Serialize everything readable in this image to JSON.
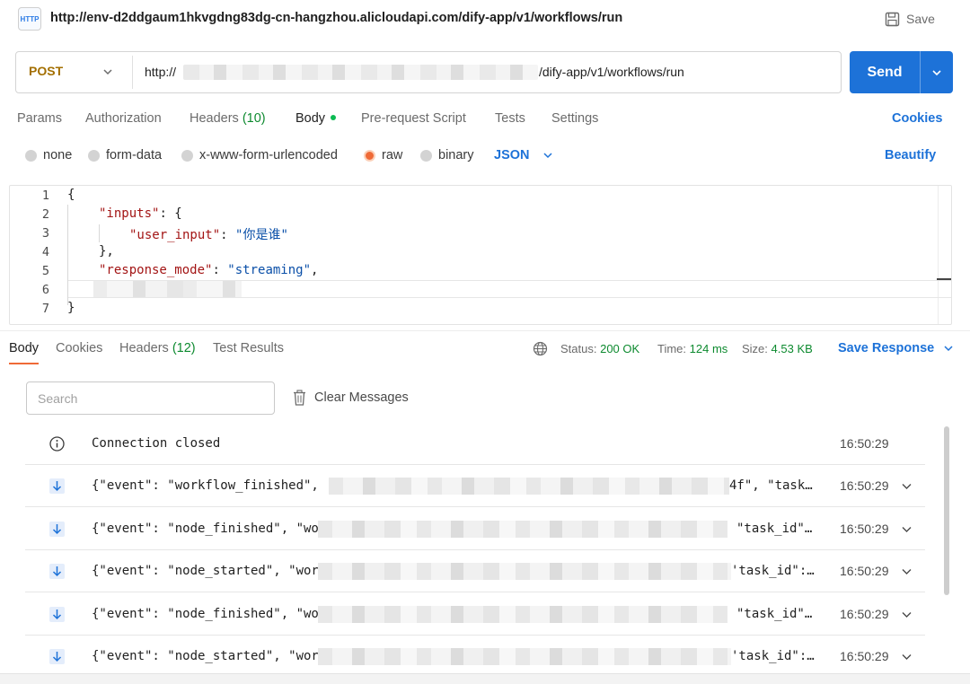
{
  "request": {
    "title": "http://env-d2ddgaum1hkvgdng83dg-cn-hangzhou.alicloudapi.com/dify-app/v1/workflows/run",
    "save_label": "Save",
    "method": "POST",
    "url_prefix": "http://",
    "url_suffix": "/dify-app/v1/workflows/run",
    "send_label": "Send",
    "icon_label": "HTTP"
  },
  "request_tabs": [
    {
      "label": "Params"
    },
    {
      "label": "Authorization"
    },
    {
      "label": "Headers",
      "count": "(10)"
    },
    {
      "label": "Body"
    },
    {
      "label": "Pre-request Script"
    },
    {
      "label": "Tests"
    },
    {
      "label": "Settings"
    }
  ],
  "cookies_label": "Cookies",
  "body_types": [
    {
      "label": "none",
      "selected": false
    },
    {
      "label": "form-data",
      "selected": false
    },
    {
      "label": "x-www-form-urlencoded",
      "selected": false
    },
    {
      "label": "raw",
      "selected": true
    },
    {
      "label": "binary",
      "selected": false
    }
  ],
  "body_format": "JSON",
  "beautify_label": "Beautify",
  "editor": {
    "line_numbers": [
      "1",
      "2",
      "3",
      "4",
      "5",
      "6",
      "7"
    ],
    "l1": "{",
    "l2_key": "\"inputs\"",
    "l2_rest": ": {",
    "l3_key": "\"user_input\"",
    "l3_colon": ": ",
    "l3_val": "\"你是谁\"",
    "l4": "},",
    "l5_key": "\"response_mode\"",
    "l5_colon": ": ",
    "l5_val": "\"streaming\"",
    "l5_comma": ",",
    "l7": "}"
  },
  "response_tabs": [
    {
      "label": "Body"
    },
    {
      "label": "Cookies"
    },
    {
      "label": "Headers",
      "count": "(12)"
    },
    {
      "label": "Test Results"
    }
  ],
  "status": {
    "status_label": "Status:",
    "status_value": "200 OK",
    "time_label": "Time:",
    "time_value": "124 ms",
    "size_label": "Size:",
    "size_value": "4.53 KB"
  },
  "save_response_label": "Save Response",
  "search_placeholder": "Search",
  "clear_label": "Clear Messages",
  "messages": [
    {
      "icon": "info-icon",
      "text": "Connection closed",
      "tail": "",
      "time": "16:50:29"
    },
    {
      "icon": "arrow-down-icon",
      "text": "{\"event\": \"workflow_finished\",",
      "tail": "4f\", \"task…",
      "time": "16:50:29"
    },
    {
      "icon": "arrow-down-icon",
      "text": "{\"event\": \"node_finished\", \"wo",
      "tail": "\"task_id\"…",
      "time": "16:50:29"
    },
    {
      "icon": "arrow-down-icon",
      "text": "{\"event\": \"node_started\", \"wor",
      "tail": "'task_id\":…",
      "time": "16:50:29"
    },
    {
      "icon": "arrow-down-icon",
      "text": "{\"event\": \"node_finished\", \"wo",
      "tail": "\"task_id\"…",
      "time": "16:50:29"
    },
    {
      "icon": "arrow-down-icon",
      "text": "{\"event\": \"node_started\", \"wor",
      "tail": "'task_id\":…",
      "time": "16:50:29"
    }
  ],
  "colors": {
    "accent": "#1d72d8",
    "method": "#a36f00",
    "status_ok": "#0d8a2f",
    "active_tab": "#ef6a37"
  }
}
